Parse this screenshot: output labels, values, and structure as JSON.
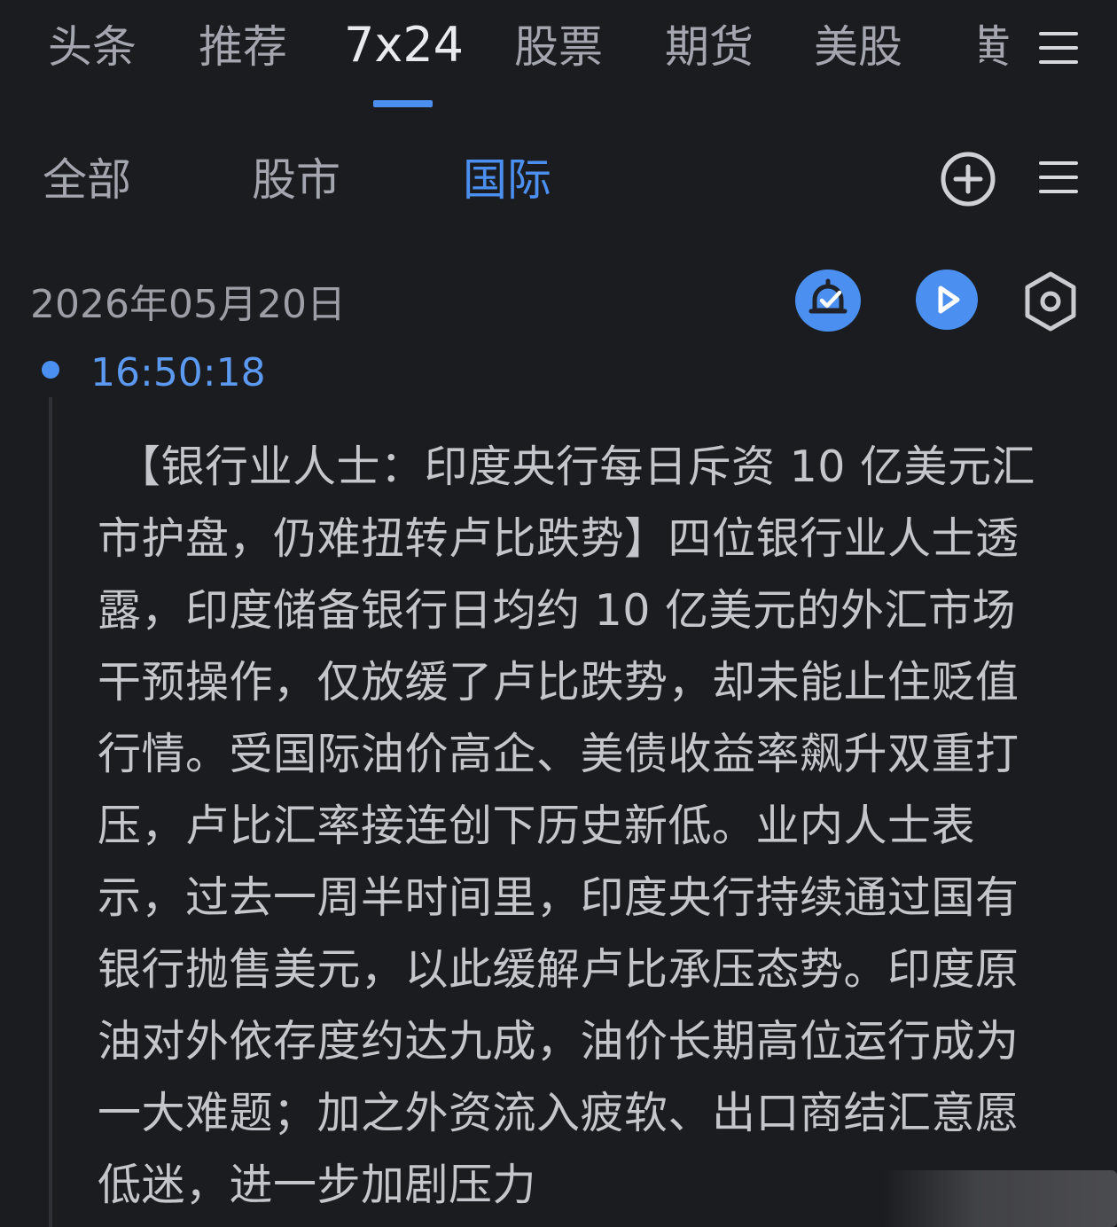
{
  "top_nav": {
    "tabs": [
      {
        "label": "头条"
      },
      {
        "label": "推荐"
      },
      {
        "label": "7x24"
      },
      {
        "label": "股票"
      },
      {
        "label": "期货"
      },
      {
        "label": "美股"
      },
      {
        "label": "黄"
      }
    ],
    "active_index": 2,
    "menu_icon": "menu-icon"
  },
  "sub_nav": {
    "tabs": [
      {
        "label": "全部"
      },
      {
        "label": "股市"
      },
      {
        "label": "国际"
      }
    ],
    "active_index": 2,
    "add_icon": "plus-circle-icon",
    "menu_icon": "menu-icon"
  },
  "feed": {
    "date": "2026年05月20日",
    "actions": [
      "alarm-check-icon",
      "play-icon",
      "hexagon-settings-icon"
    ],
    "items": [
      {
        "time": "16:50:18",
        "content": "【银行业人士：印度央行每日斥资 10 亿美元汇市护盘，仍难扭转卢比跌势】四位银行业人士透露，印度储备银行日均约 10 亿美元的外汇市场干预操作，仅放缓了卢比跌势，却未能止住贬值行情。受国际油价高企、美债收益率飙升双重打压，卢比汇率接连创下历史新低。业内人士表示，过去一周半时间里，印度央行持续通过国有银行抛售美元，以此缓解卢比承压态势。印度原油对外依存度约达九成，油价长期高位运行成为一大难题；加之外资流入疲软、出口商结汇意愿低迷，进一步加剧压力"
      }
    ]
  },
  "colors": {
    "background": "#1b1c20",
    "accent": "#4b8ff0",
    "text": "#c4c6cc",
    "muted": "#a3a6ae"
  }
}
